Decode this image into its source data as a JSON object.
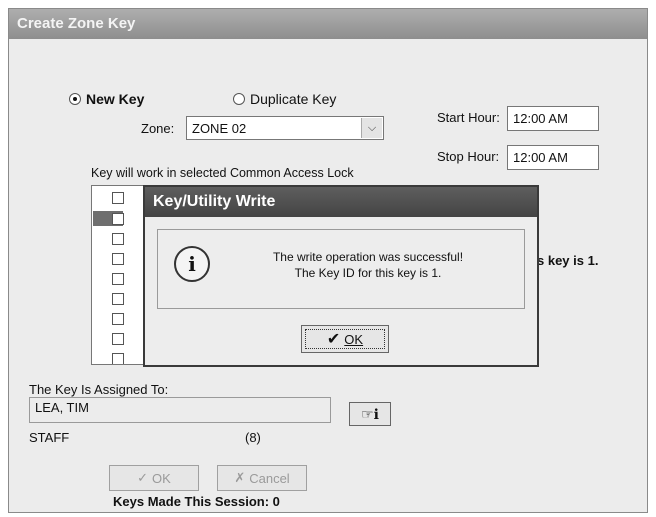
{
  "window": {
    "title": "Create Zone Key"
  },
  "key_type": {
    "new_label": "New Key",
    "duplicate_label": "Duplicate Key",
    "selected": "new"
  },
  "zone": {
    "label": "Zone:",
    "value": "ZONE 02"
  },
  "hours": {
    "start_label": "Start Hour:",
    "start_value": "12:00 AM",
    "stop_label": "Stop Hour:",
    "stop_value": "12:00 AM"
  },
  "locks": {
    "label": "Key will work in selected Common Access Lock"
  },
  "partial_text": "s key is 1.",
  "dialog": {
    "title": "Key/Utility Write",
    "line1": "The write operation was successful!",
    "line2": "The Key ID for this key is 1.",
    "ok_label": "OK"
  },
  "assigned": {
    "label": "The Key Is Assigned To:",
    "name": "LEA, TIM",
    "group": "STAFF",
    "count": "(8)"
  },
  "buttons": {
    "ok_label": "OK",
    "cancel_label": "Cancel"
  },
  "session": {
    "text": "Keys Made This Session: 0"
  }
}
